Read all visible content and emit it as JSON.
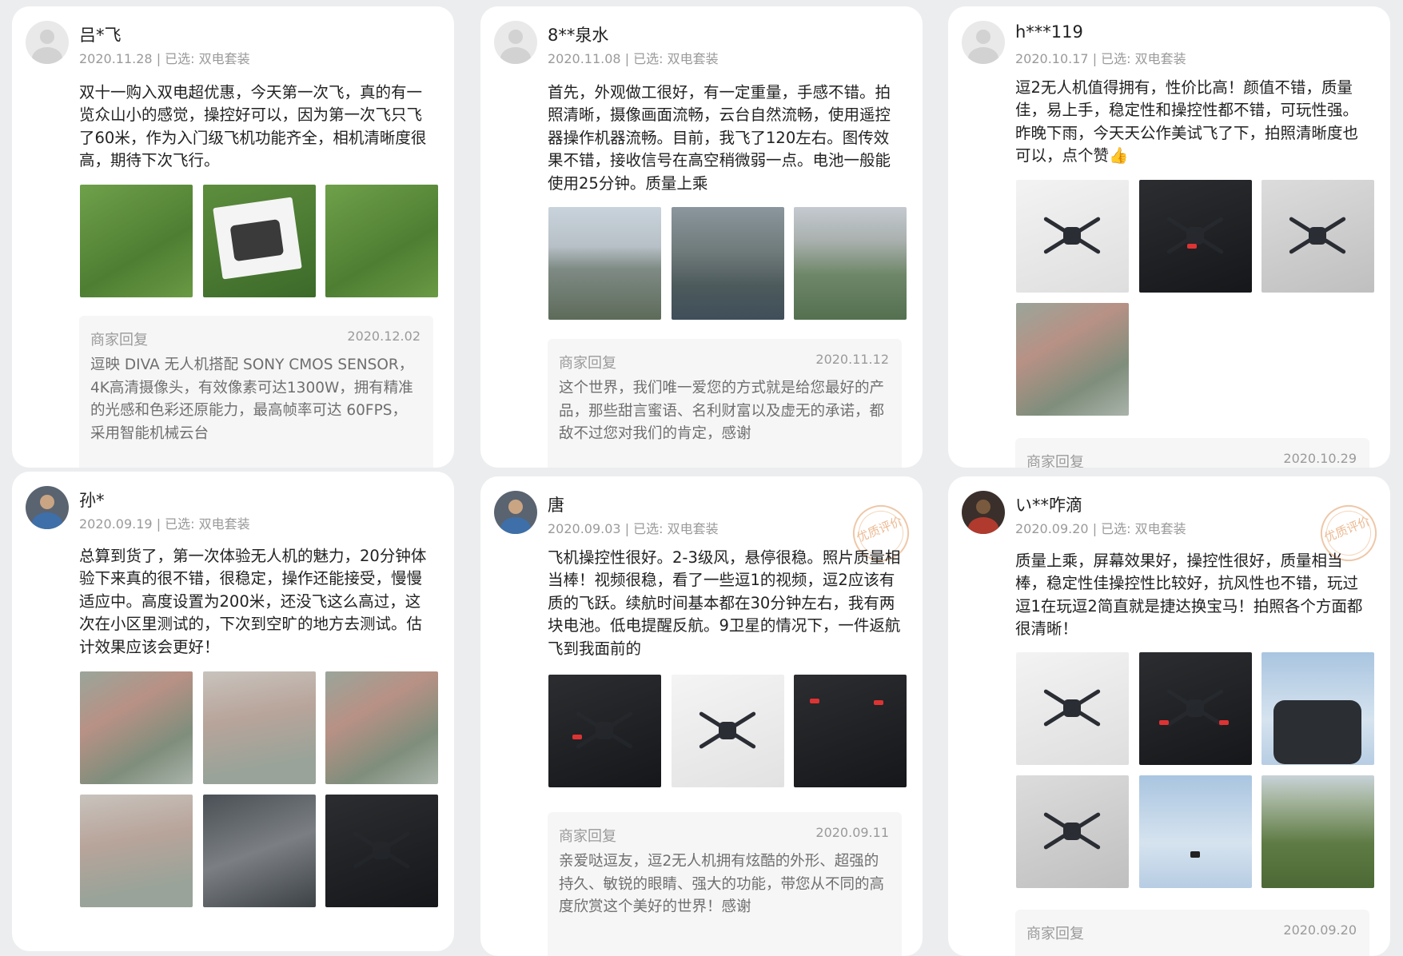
{
  "reviews": [
    {
      "user": "吕*飞",
      "meta": "2020.11.28 | 已选: 双电套装",
      "text": "双十一购入双电超优惠，今天第一次飞，真的有一览众山小的感觉，操控好可以，因为第一次飞只飞了60米，作为入门级飞机功能齐全，相机清晰度很高，期待下次飞行。",
      "reply_title": "商家回复",
      "reply_date": "2020.12.02",
      "reply_text": "逗映 DIVA 无人机搭配 SONY CMOS SENSOR，4K高清摄像头，有效像素可达1300W，拥有精准的光感和色彩还原能力，最高帧率可达 60FPS，采用智能机械云台"
    },
    {
      "user": "8**泉水",
      "meta": "2020.11.08 | 已选: 双电套装",
      "text": "首先，外观做工很好，有一定重量，手感不错。拍照清晰，摄像画面流畅，云台自然流畅，使用遥控器操作机器流畅。目前，我飞了120左右。图传效果不错，接收信号在高空稍微弱一点。电池一般能使用25分钟。质量上乘",
      "reply_title": "商家回复",
      "reply_date": "2020.11.12",
      "reply_text": "这个世界，我们唯一爱您的方式就是给您最好的产品，那些甜言蜜语、名利财富以及虚无的承诺，都敌不过您对我们的肯定，感谢"
    },
    {
      "user": "h***119",
      "meta": "2020.10.17 | 已选: 双电套装",
      "text": "逗2无人机值得拥有，性价比高！颜值不错，质量佳，易上手，稳定性和操控性都不错，可玩性强。昨晚下雨，今天天公作美试飞了下，拍照清晰度也可以，点个赞👍",
      "reply_title": "商家回复",
      "reply_date": "2020.10.29"
    },
    {
      "user": "孙*",
      "meta": "2020.09.19 | 已选: 双电套装",
      "text": "总算到货了，第一次体验无人机的魅力，20分钟体验下来真的很不错，很稳定，操作还能接受，慢慢适应中。高度设置为200米，还没飞这么高过，这次在小区里测试的，下次到空旷的地方去测试。估计效果应该会更好！"
    },
    {
      "user": "唐",
      "meta": "2020.09.03 | 已选: 双电套装",
      "badge": "优质评价",
      "text": "飞机操控性很好。2-3级风，悬停很稳。照片质量相当棒！视频很稳，看了一些逗1的视频，逗2应该有质的飞跃。续航时间基本都在30分钟左右，我有两块电池。低电提醒反航。9卫星的情况下，一件返航飞到我面前的",
      "reply_title": "商家回复",
      "reply_date": "2020.09.11",
      "reply_text": "亲爱哒逗友，逗2无人机拥有炫酷的外形、超强的持久、敏锐的眼睛、强大的功能，带您从不同的高度欣赏这个美好的世界！感谢"
    },
    {
      "user": "い**咋滴",
      "meta": "2020.09.20 | 已选: 双电套装",
      "badge": "优质评价",
      "text": "质量上乘，屏幕效果好，操控性很好，质量相当棒，稳定性佳操控性比较好，抗风性也不错，玩过逗1在玩逗2简直就是捷达换宝马！拍照各个方面都很清晰！",
      "reply_title": "商家回复",
      "reply_date": "2020.09.20"
    }
  ]
}
